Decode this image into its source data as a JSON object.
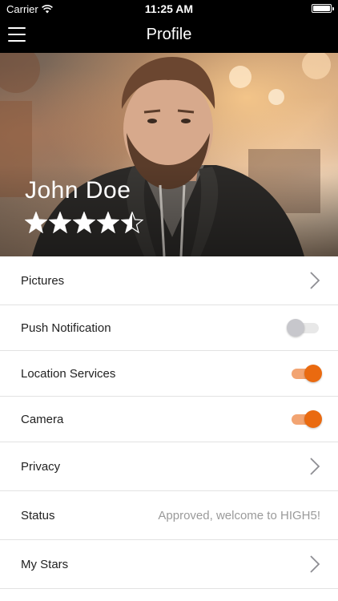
{
  "status_bar": {
    "carrier": "Carrier",
    "time": "11:25 AM"
  },
  "nav": {
    "title": "Profile",
    "menu_icon": "hamburger-menu-icon"
  },
  "profile": {
    "name": "John Doe",
    "rating": 4.5,
    "rating_max": 5
  },
  "settings": [
    {
      "label": "Pictures",
      "accessory": "chevron"
    },
    {
      "label": "Push Notification",
      "accessory": "toggle",
      "on": false
    },
    {
      "label": "Location Services",
      "accessory": "toggle",
      "on": true
    },
    {
      "label": "Camera",
      "accessory": "toggle",
      "on": true
    },
    {
      "label": "Privacy",
      "accessory": "chevron"
    },
    {
      "label": "Status",
      "accessory": "value",
      "value": "Approved, welcome to HIGH5!"
    },
    {
      "label": "My Stars",
      "accessory": "chevron"
    }
  ],
  "colors": {
    "accent": "#ea6a10",
    "accent_track": "#f2a472",
    "bar": "#000000"
  }
}
